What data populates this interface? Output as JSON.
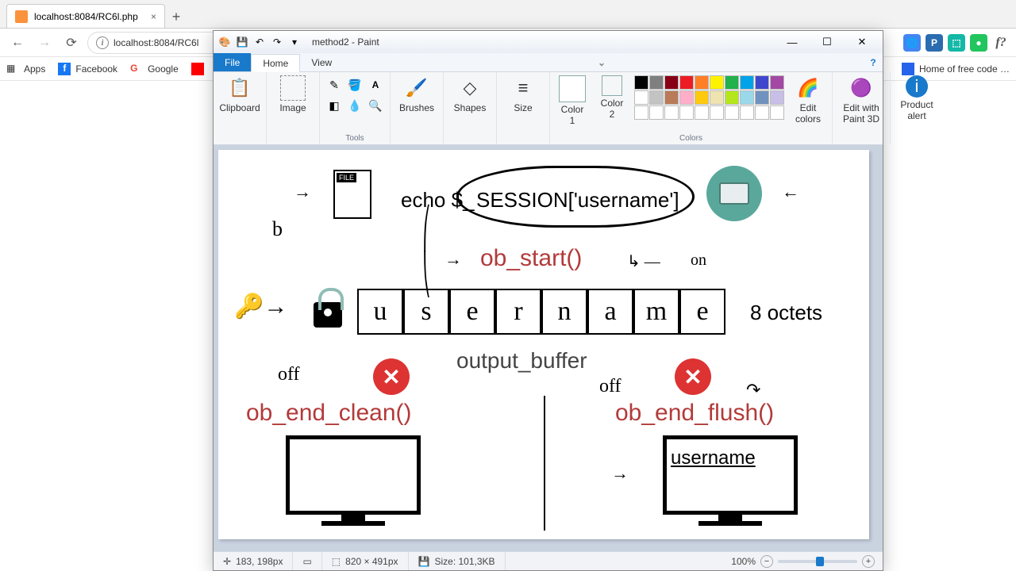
{
  "browser": {
    "tab_title": "localhost:8084/RC6l.php",
    "url": "localhost:8084/RC6l",
    "bookmarks": {
      "apps": "Apps",
      "fb": "Facebook",
      "google": "Google",
      "yt": ""
    },
    "right_bookmark": "Home of free code …"
  },
  "paint": {
    "title": "method2 - Paint",
    "tabs": {
      "file": "File",
      "home": "Home",
      "view": "View"
    },
    "groups": {
      "clipboard": "Clipboard",
      "image": "Image",
      "tools": "Tools",
      "brushes": "Brushes",
      "shapes": "Shapes",
      "size": "Size",
      "color1": "Color\n1",
      "color2": "Color\n2",
      "colors": "Colors",
      "edit_colors": "Edit\ncolors",
      "paint3d": "Edit with\nPaint 3D",
      "alert": "Product\nalert"
    },
    "palette": [
      "#000000",
      "#7f7f7f",
      "#880015",
      "#ed1c24",
      "#ff7f27",
      "#fff200",
      "#22b14c",
      "#00a2e8",
      "#3f48cc",
      "#a349a4",
      "#ffffff",
      "#c3c3c3",
      "#b97a57",
      "#ffaec9",
      "#ffc90e",
      "#efe4b0",
      "#b5e61d",
      "#99d9ea",
      "#7092be",
      "#c8bfe7",
      "#ffffff",
      "#ffffff",
      "#ffffff",
      "#ffffff",
      "#ffffff",
      "#ffffff",
      "#ffffff",
      "#ffffff",
      "#ffffff",
      "#ffffff"
    ],
    "color1": "#ffffff",
    "color2": "#ffffff"
  },
  "status": {
    "cursor": "183, 198px",
    "canvas_size": "820 × 491px",
    "file_size": "Size: 101,3KB",
    "zoom": "100%"
  },
  "canvas": {
    "file_label": "FILE",
    "echo": "echo $_",
    "session": "SESSION['username']",
    "ob_start": "ob_start()",
    "output_buffer": "output_buffer",
    "ob_end_clean": "ob_end_clean()",
    "ob_end_flush": "ob_end_flush()",
    "octets": "8 octets",
    "buffer": [
      "u",
      "s",
      "e",
      "r",
      "n",
      "a",
      "m",
      "e"
    ],
    "screen_text": "username"
  }
}
